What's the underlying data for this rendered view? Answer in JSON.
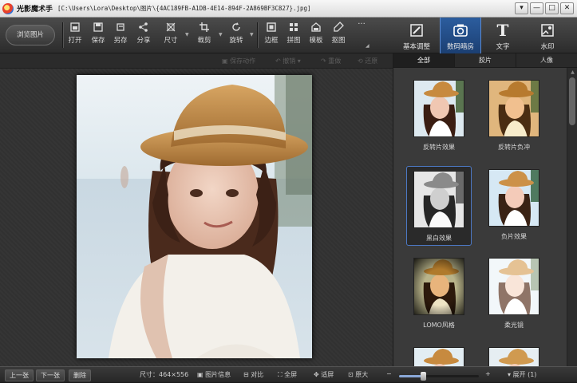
{
  "window": {
    "app_name": "光影魔术手",
    "path": "[C:\\Users\\Lora\\Desktop\\图片\\{4AC189FB-A1DB-4E14-894F-2A869BF3C827}.jpg]",
    "buttons": [
      "▾",
      "—",
      "□",
      "✕"
    ]
  },
  "toolbar": {
    "browse": "浏览图片",
    "tools": [
      {
        "label": "打开",
        "icon": "open-icon"
      },
      {
        "label": "保存",
        "icon": "save-icon"
      },
      {
        "label": "另存",
        "icon": "save-as-icon"
      },
      {
        "label": "分享",
        "icon": "share-icon"
      },
      {
        "label": "尺寸",
        "icon": "resize-icon"
      },
      {
        "label": "裁剪",
        "icon": "crop-icon"
      },
      {
        "label": "旋转",
        "icon": "rotate-icon"
      },
      {
        "label": "边框",
        "icon": "border-icon"
      },
      {
        "label": "拼图",
        "icon": "collage-icon"
      },
      {
        "label": "模板",
        "icon": "template-icon"
      },
      {
        "label": "抠图",
        "icon": "cutout-icon"
      },
      {
        "label": "...",
        "icon": "more-icon"
      }
    ],
    "right_tabs": [
      {
        "label": "基本调整",
        "icon": "basic-adjust-icon"
      },
      {
        "label": "数码暗房",
        "icon": "camera-icon"
      },
      {
        "label": "文字",
        "icon": "text-icon"
      },
      {
        "label": "水印",
        "icon": "watermark-icon"
      }
    ]
  },
  "subbar": {
    "save_action": "保存动作",
    "undo": "撤销",
    "redo": "重做",
    "restore": "还原"
  },
  "panel": {
    "tabs": [
      "全部",
      "胶片",
      "人像"
    ],
    "active_tab": "全部",
    "effects": [
      {
        "label": "反转片效果",
        "style": "vivid"
      },
      {
        "label": "反转片负冲",
        "style": "cross"
      },
      {
        "label": "黑白效果",
        "style": "bw",
        "selected": true
      },
      {
        "label": "负片效果",
        "style": "negative"
      },
      {
        "label": "LOMO风格",
        "style": "lomo"
      },
      {
        "label": "柔光镜",
        "style": "soft"
      },
      {
        "label": "",
        "style": "vivid"
      },
      {
        "label": "",
        "style": "normal"
      }
    ]
  },
  "status": {
    "prev": "上一张",
    "next": "下一张",
    "delete": "删除",
    "size_label": "尺寸：464×556",
    "info": "图片信息",
    "compare": "对比",
    "fullscreen": "全屏",
    "fit": "适屏",
    "original": "原大",
    "zoom_minus": "−",
    "zoom_plus": "+",
    "zoom_level": 0.3,
    "expand": "▾ 展开 (1)"
  }
}
